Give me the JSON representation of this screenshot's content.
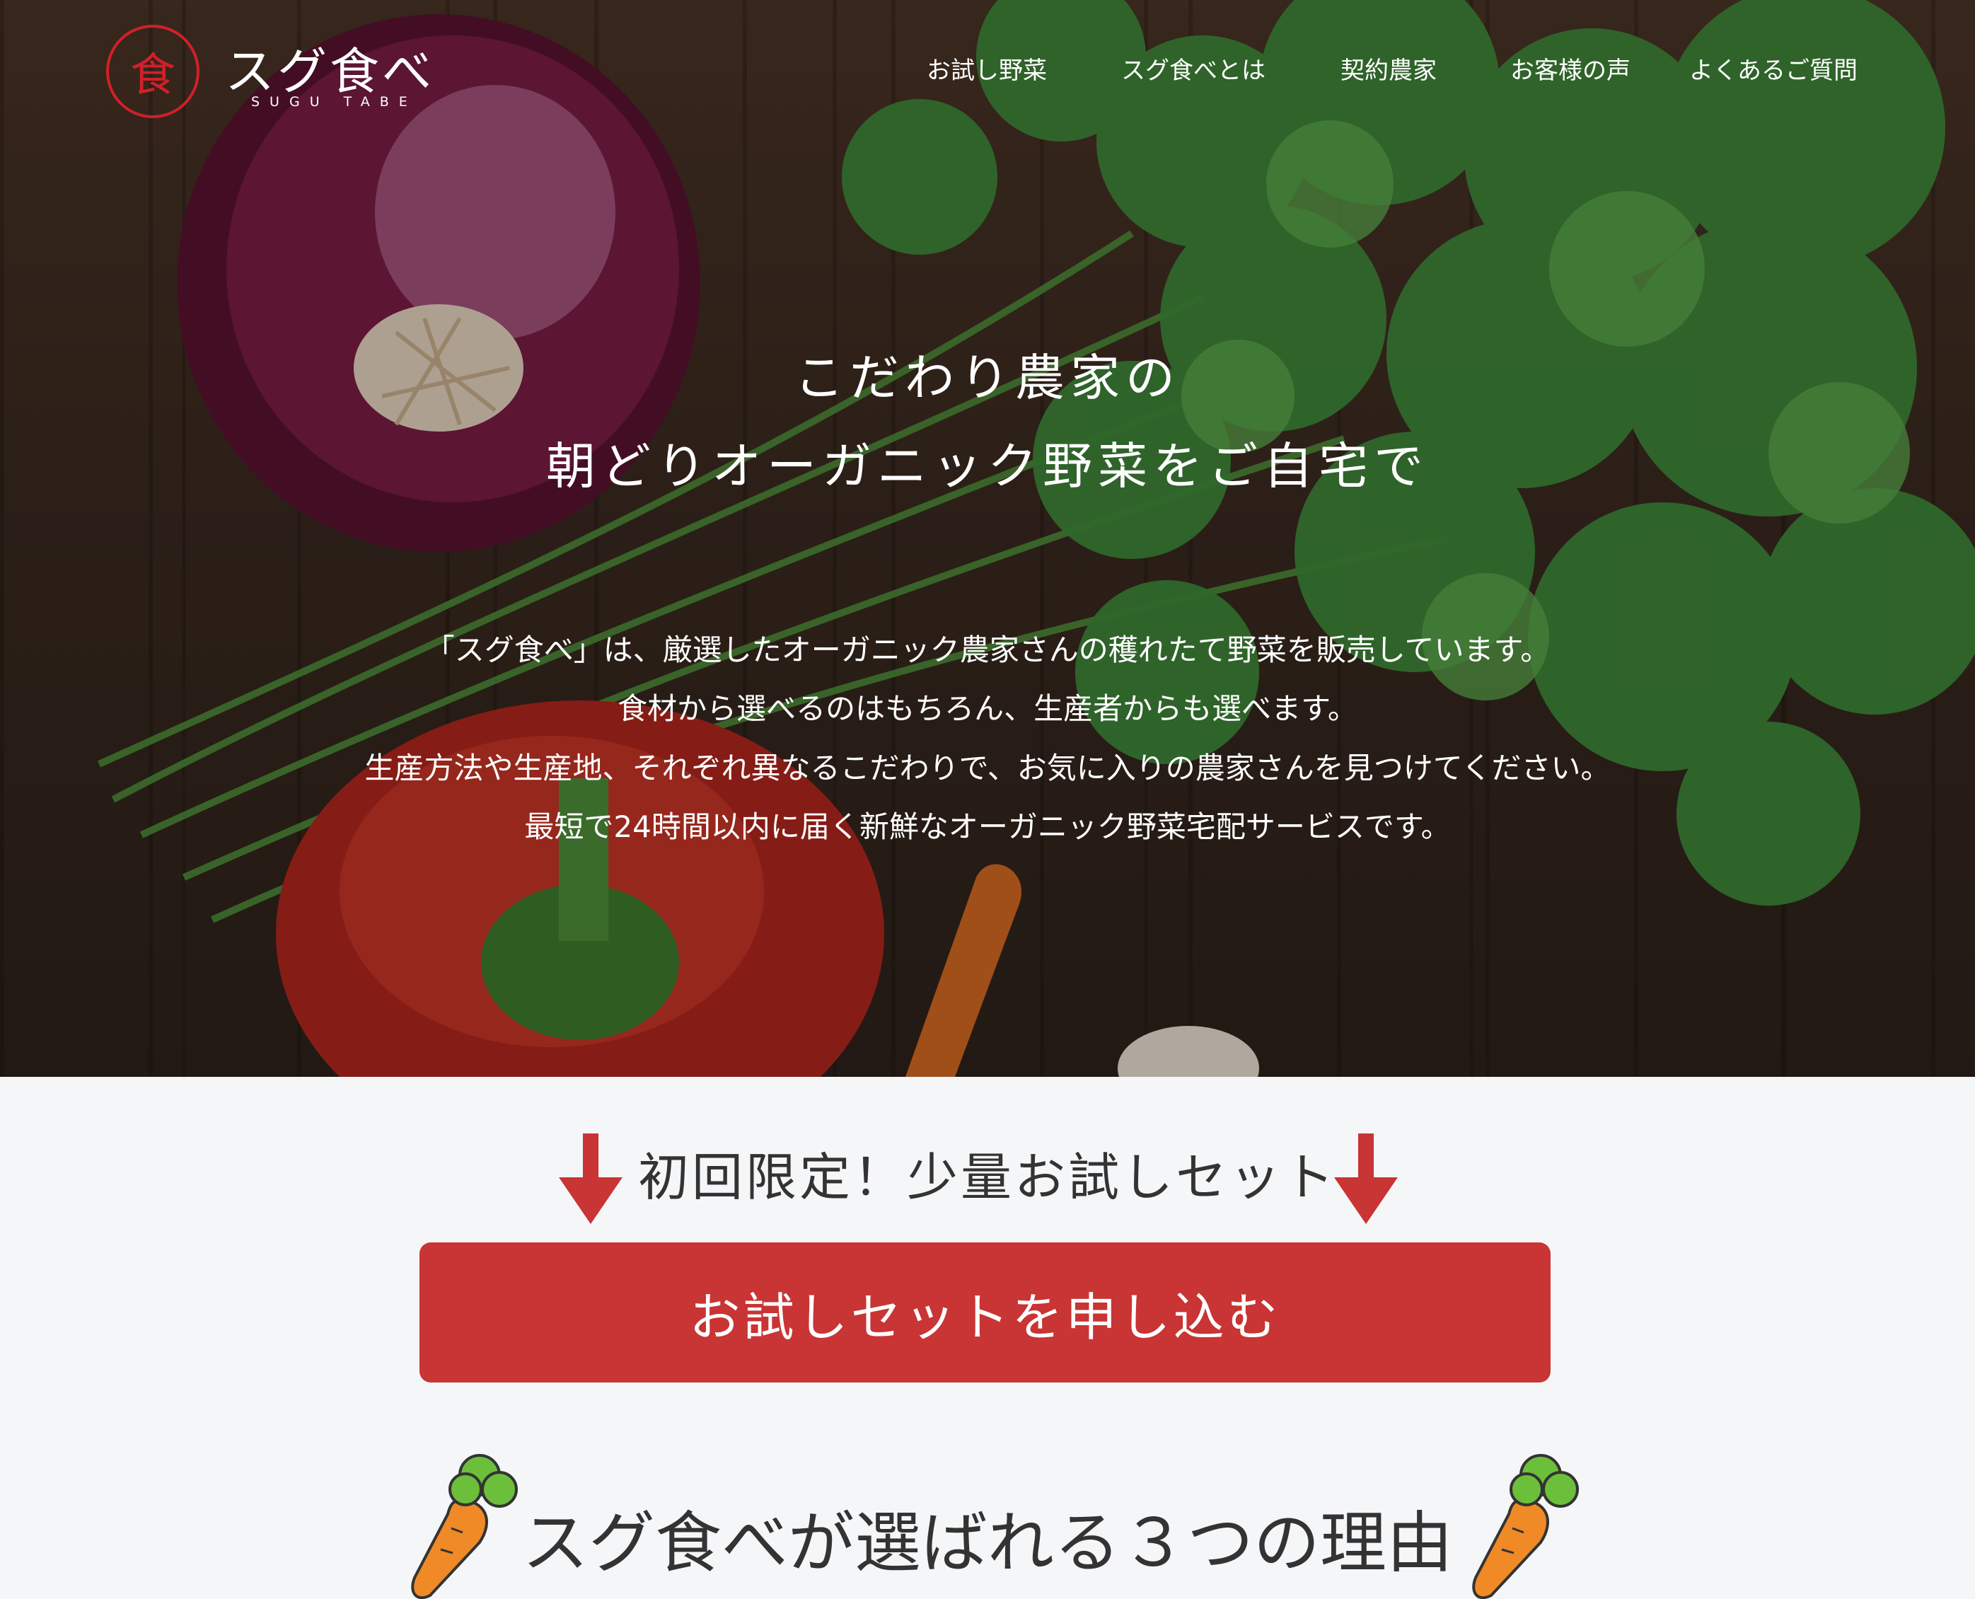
{
  "brand": {
    "logo_mark": "食",
    "name": "スグ食べ",
    "sub": "SUGU TABE",
    "accent_color": "#d0202a"
  },
  "nav": {
    "items": [
      {
        "label": "お試し野菜"
      },
      {
        "label": "スグ食べとは"
      },
      {
        "label": "契約農家"
      },
      {
        "label": "お客様の声"
      },
      {
        "label": "よくあるご質問"
      }
    ]
  },
  "hero": {
    "headline_line1": "こだわり農家の",
    "headline_line2": "朝どりオーガニック野菜をご自宅で",
    "desc_lines": [
      "「スグ食べ」は、厳選したオーガニック農家さんの穫れたて野菜を販売しています。",
      "食材から選べるのはもちろん、生産者からも選べます。",
      "生産方法や生産地、それぞれ異なるこだわりで、お気に入りの農家さんを見つけてください。",
      "最短で24時間以内に届く新鮮なオーガニック野菜宅配サービスです。"
    ]
  },
  "cta": {
    "label": "初回限定！少量お試しセット",
    "button_label": "お試しセットを申し込む",
    "button_color": "#c93434",
    "arrow_icon": "arrow-down-icon"
  },
  "reasons": {
    "title": "スグ食べが選ばれる３つの理由",
    "decoration_icon": "carrot-icon"
  }
}
